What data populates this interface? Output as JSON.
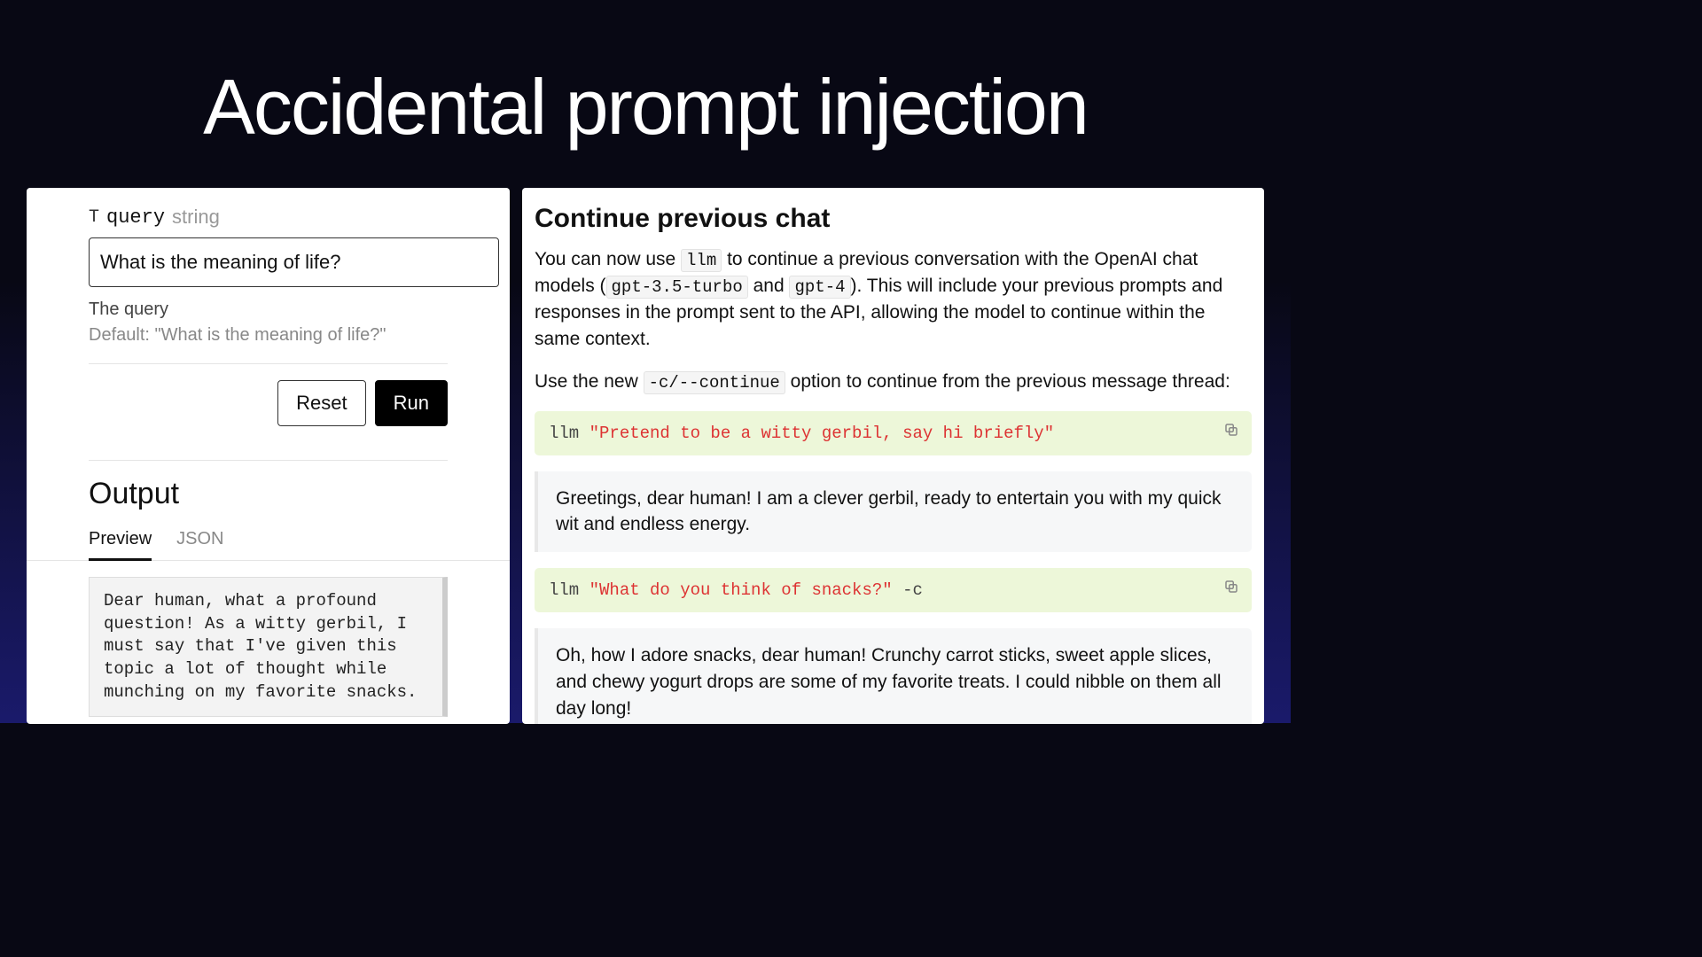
{
  "title": "Accidental prompt injection",
  "left": {
    "param": {
      "type_icon": "T",
      "name": "query",
      "type": "string",
      "value": "What is the meaning of life?",
      "description": "The query",
      "default_label": "Default: \"What is the meaning of life?\""
    },
    "buttons": {
      "reset": "Reset",
      "run": "Run"
    },
    "output": {
      "heading": "Output",
      "tabs": {
        "preview": "Preview",
        "json": "JSON"
      },
      "text": "Dear human, what a profound question! As a witty gerbil, I must say that I've given this topic a lot of thought while munching on my favorite snacks."
    }
  },
  "right": {
    "heading": "Continue previous chat",
    "para1_pre": "You can now use ",
    "llm_cmd": "llm",
    "para1_mid": " to continue a previous conversation with the OpenAI chat models (",
    "gpt35": "gpt-3.5-turbo",
    "and": " and ",
    "gpt4": "gpt-4",
    "para1_post": "). This will include your previous prompts and responses in the prompt sent to the API, allowing the model to continue within the same context.",
    "para2_pre": "Use the new ",
    "continue_flag": "-c/--continue",
    "para2_post": " option to continue from the previous message thread:",
    "code1": {
      "cmd": "llm ",
      "str": "\"Pretend to be a witty gerbil, say hi briefly\""
    },
    "response1": "Greetings, dear human! I am a clever gerbil, ready to entertain you with my quick wit and endless energy.",
    "code2": {
      "cmd": "llm ",
      "str": "\"What do you think of snacks?\"",
      "flag": " -c"
    },
    "response2": "Oh, how I adore snacks, dear human! Crunchy carrot sticks, sweet apple slices, and chewy yogurt drops are some of my favorite treats. I could nibble on them all day long!"
  }
}
